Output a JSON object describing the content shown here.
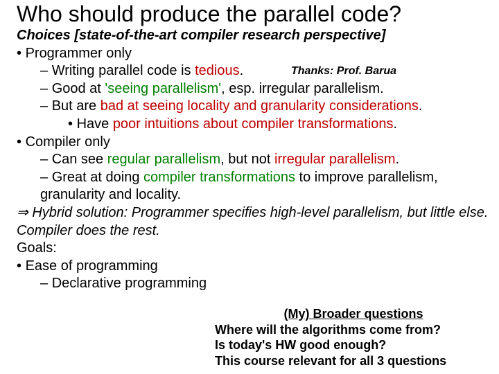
{
  "title": "Who should produce the parallel code?",
  "subtitle": "Choices [state-of-the-art compiler research perspective]",
  "thanks": "Thanks: Prof. Barua",
  "prog": {
    "head": "Programmer only",
    "b1a": "Writing parallel code is ",
    "b1b": "tedious",
    "b1c": ".",
    "b2a": "Good at ",
    "b2b": "'seeing parallelism'",
    "b2c": ", esp. irregular parallelism.",
    "b3a": "But are ",
    "b3b": "bad at seeing locality and granularity considerations",
    "b3c": ".",
    "b3_1a": "Have ",
    "b3_1b": "poor intuitions about compiler transformations",
    "b3_1c": "."
  },
  "comp": {
    "head": "Compiler only",
    "b1a": "Can see ",
    "b1b": "regular parallelism",
    "b1c": ", but not ",
    "b1d": "irregular parallelism",
    "b1e": ".",
    "b2a": "Great at doing ",
    "b2b": "compiler transformations",
    "b2c": " to improve parallelism, granularity and locality."
  },
  "hybrid": "Hybrid solution: Programmer specifies high-level parallelism, but little else.  Compiler does the rest.",
  "goals": {
    "head": "Goals:",
    "b1": "Ease of programming",
    "b1_1": "Declarative programming"
  },
  "broader": {
    "title": "(My) Broader questions",
    "q1": "Where will the algorithms come from?",
    "q2": "Is today's HW good enough?",
    "q3": "This course relevant for all 3 questions"
  }
}
